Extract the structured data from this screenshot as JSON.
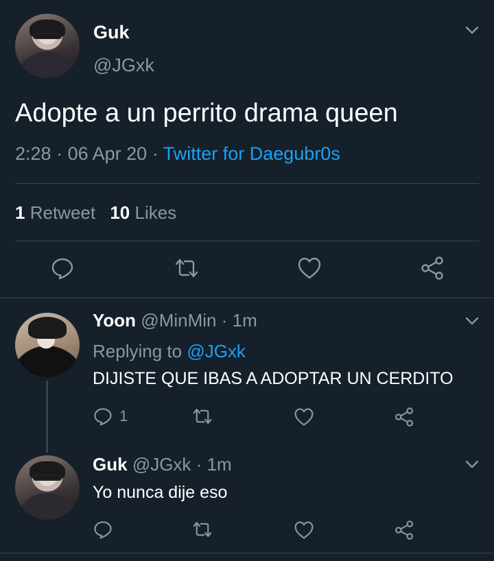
{
  "main_tweet": {
    "name": "Guk",
    "handle": "@JGxk",
    "text": "Adopte a un perrito drama queen",
    "time": "2:28",
    "date": "06 Apr 20",
    "source": "Twitter for Daegubr0s",
    "retweets_count": "1",
    "retweets_label": "Retweet",
    "likes_count": "10",
    "likes_label": "Likes"
  },
  "reply1": {
    "name": "Yoon",
    "handle": "@MinMin",
    "time": "1m",
    "replying_label": "Replying to",
    "replying_handle": "@JGxk",
    "text": "DIJISTE QUE IBAS A ADOPTAR UN CERDITO",
    "reply_count": "1"
  },
  "reply2": {
    "name": "Guk",
    "handle": "@JGxk",
    "time": "1m",
    "text": "Yo nunca dije eso"
  },
  "separator": "·",
  "colors": {
    "background": "#15202b",
    "muted": "#8899a6",
    "link": "#1da1f2",
    "divider": "#38444d"
  }
}
